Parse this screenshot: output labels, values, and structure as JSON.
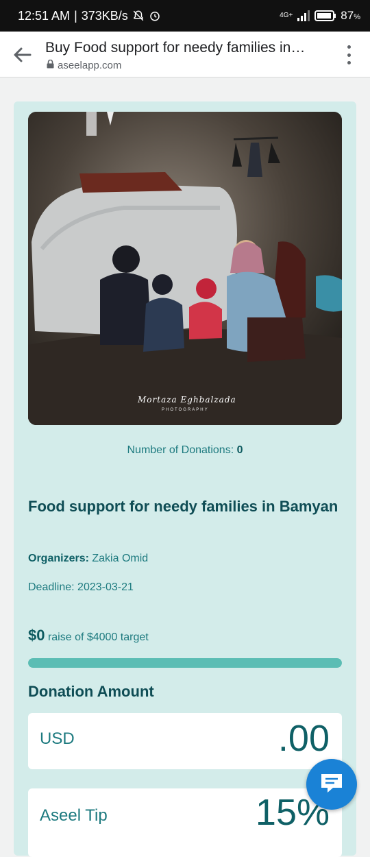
{
  "status": {
    "time": "12:51 AM",
    "speed": "373KB/s",
    "network": "4G+",
    "battery": "87",
    "battery_unit": "%"
  },
  "browser": {
    "title": "Buy Food support for needy families in Bamyan",
    "domain": "aseelapp.com"
  },
  "campaign": {
    "photo_signature": "Mortaza Eghbalzada",
    "photo_sub": "PHOTOGRAPHY",
    "donations_label": "Number of Donations:",
    "donations_count": "0",
    "title": "Food support for needy families in Bamyan",
    "organizers_label": "Organizers:",
    "organizer_name": "Zakia Omid",
    "deadline": "Deadline: 2023-03-21",
    "raised": "$0",
    "raise_text": "raise of $4000 target",
    "progress_fraction": 1.0
  },
  "donation": {
    "section_title": "Donation Amount",
    "currency": "USD",
    "amount": ".00",
    "tip_label": "Aseel Tip",
    "tip_value": "15%"
  },
  "colors": {
    "accent": "#1d7a7f",
    "card_bg": "#d3ecea",
    "chat_button": "#1a82d6"
  }
}
